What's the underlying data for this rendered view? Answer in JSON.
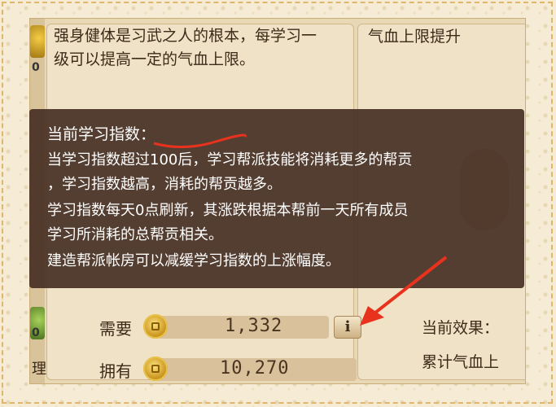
{
  "description_text": "强身健体是习武之人的根本，每学习一级可以提高一定的气血上限。",
  "right_title": "气血上限提升",
  "left_strip": {
    "num_top": "0",
    "num_bottom": "0",
    "bottom_label": "理"
  },
  "tooltip": {
    "title": "当前学习指数：",
    "lines": [
      "当学习指数超过100后，学习帮派技能将消耗更多的帮贡",
      "，学习指数越高，消耗的帮贡越多。",
      "学习指数每天0点刷新，其涨跌根据本帮前一天所有成员",
      "学习所消耗的总帮贡相关。",
      "建造帮派帐房可以减缓学习指数的上涨幅度。"
    ]
  },
  "cost": {
    "need_label": "需要",
    "need_value": "1,332",
    "have_label": "拥有",
    "have_value": "10,270"
  },
  "info_button": "i",
  "effect": {
    "label": "当前效果：",
    "value": "累计气血上"
  },
  "colors": {
    "tooltip_bg": "#46302480",
    "annotation": "#e8321e"
  }
}
